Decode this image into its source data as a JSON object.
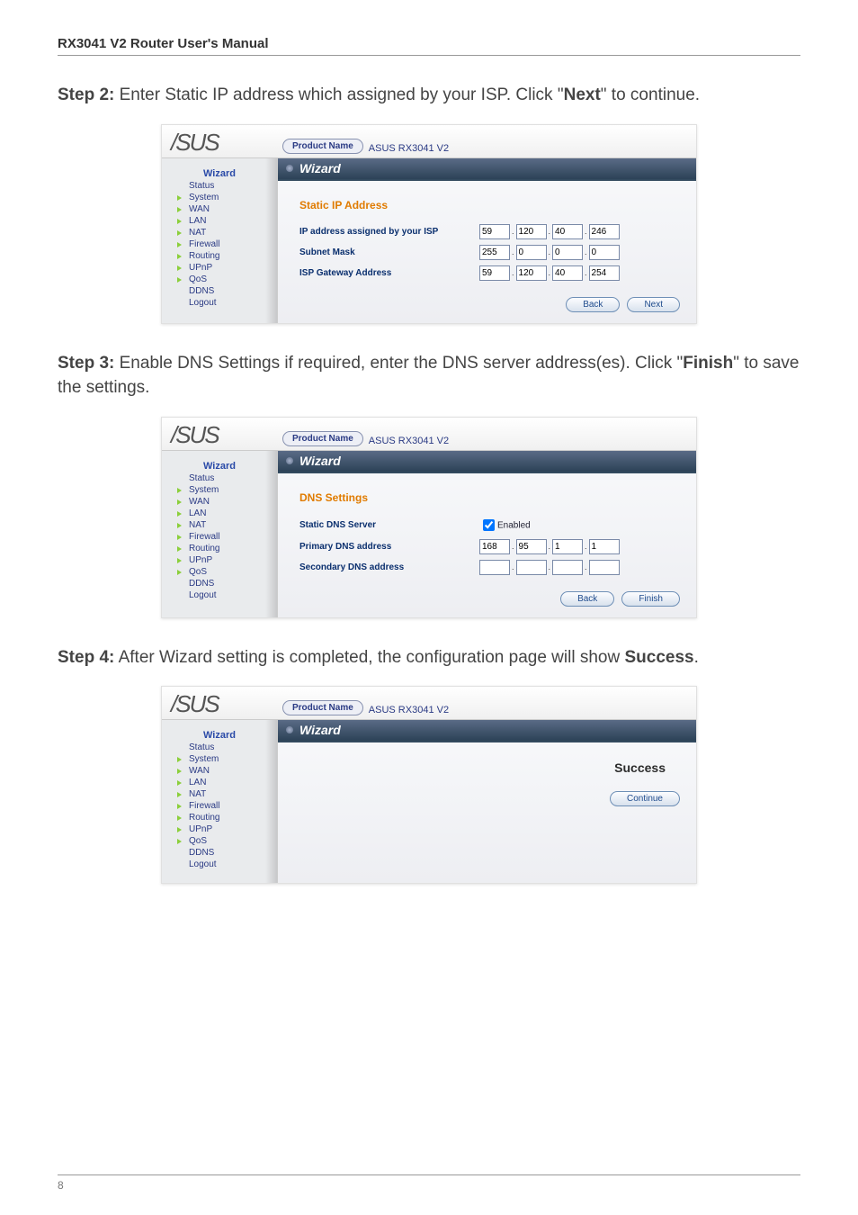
{
  "manual_header": "RX3041 V2 Router User's Manual",
  "page_number": "8",
  "steps": {
    "s2": {
      "lead": "Step 2:",
      "text_a": " Enter Static IP address which assigned by your ISP. Click \"",
      "kw": "Next",
      "text_b": "\" to continue."
    },
    "s3": {
      "lead": "Step 3:",
      "text_a": " Enable DNS Settings if required, enter the DNS server address(es). Click \"",
      "kw": "Finish",
      "text_b": "\" to save the settings."
    },
    "s4": {
      "lead": "Step 4:",
      "text_a": " After Wizard setting is completed, the configuration page will show ",
      "kw": "Success",
      "text_b": "."
    }
  },
  "common": {
    "product_name_label": "Product Name",
    "product_name_value": "ASUS RX3041 V2",
    "logo": "/SUS",
    "wizard_title": "Wizard",
    "nav": [
      "Wizard",
      "Status",
      "System",
      "WAN",
      "LAN",
      "NAT",
      "Firewall",
      "Routing",
      "UPnP",
      "QoS",
      "DDNS",
      "Logout"
    ]
  },
  "shot1": {
    "section": "Static IP Address",
    "rows": {
      "ip": {
        "label": "IP address assigned by your ISP",
        "v": [
          "59",
          "120",
          "40",
          "246"
        ]
      },
      "mask": {
        "label": "Subnet Mask",
        "v": [
          "255",
          "0",
          "0",
          "0"
        ]
      },
      "gw": {
        "label": "ISP Gateway Address",
        "v": [
          "59",
          "120",
          "40",
          "254"
        ]
      }
    },
    "btn_back": "Back",
    "btn_next": "Next"
  },
  "shot2": {
    "section": "DNS Settings",
    "rows": {
      "enable": {
        "label": "Static DNS Server",
        "checkbox": "Enabled"
      },
      "pri": {
        "label": "Primary DNS address",
        "v": [
          "168",
          "95",
          "1",
          "1"
        ]
      },
      "sec": {
        "label": "Secondary DNS address",
        "v": [
          "",
          "",
          "",
          ""
        ]
      }
    },
    "btn_back": "Back",
    "btn_finish": "Finish"
  },
  "shot3": {
    "success": "Success",
    "btn_continue": "Continue"
  }
}
